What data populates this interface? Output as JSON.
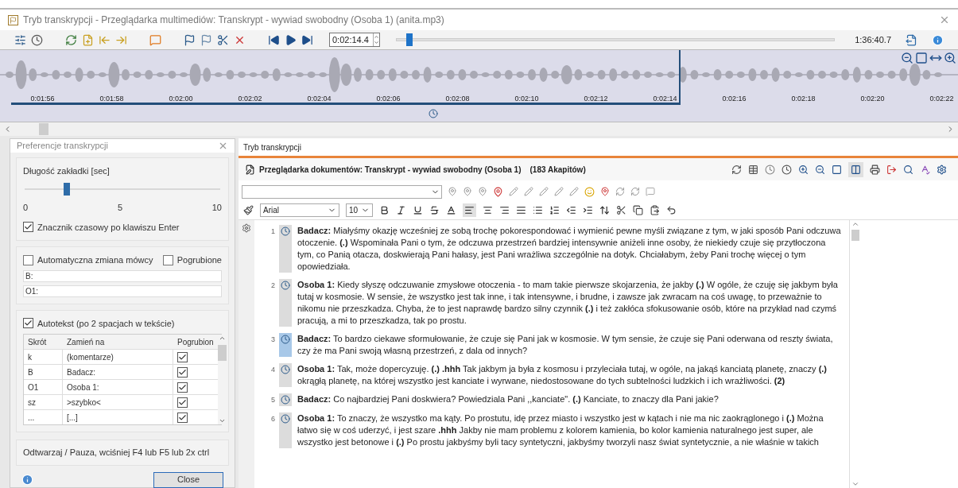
{
  "window": {
    "title": "Tryb transkrypcji - Przeglądarka multimediów: Transkrypt - wywiad swobodny (Osoba 1) (anita.mp3)"
  },
  "player": {
    "position": "0:02:14.4",
    "seek": {
      "level": 0.023
    },
    "duration": "1:36:40.7",
    "timeline": [
      "0:01:56",
      "0:01:58",
      "0:02:00",
      "0:02:02",
      "0:02:04",
      "0:02:06",
      "0:02:08",
      "0:02:10",
      "0:02:12",
      "0:02:14",
      "0:02:16",
      "0:02:18",
      "0:02:20",
      "0:02:22"
    ]
  },
  "preferences": {
    "title": "Preferencje transkrypcji",
    "tab_length": {
      "label": "Długość zakładki [sec]",
      "level": 0.2,
      "scale": [
        "0",
        "5",
        "10"
      ]
    },
    "enter_timestamp": {
      "label": "Znacznik czasowy po klawiszu Enter",
      "checked": true
    },
    "auto_speaker": {
      "label": "Automatyczna zmiana mówcy",
      "checked": false
    },
    "bold": {
      "label": "Pogrubione",
      "checked": false
    },
    "speakers": [
      "B:",
      "O1:"
    ],
    "autotext": {
      "label": "Autotekst (po 2 spacjach w tekście)",
      "checked": true,
      "columns": [
        "Skrót",
        "Zamień na",
        "Pogrubion"
      ],
      "rows": [
        {
          "abbr": "k",
          "replace": "(komentarze)",
          "bold": true
        },
        {
          "abbr": "B",
          "replace": "Badacz:",
          "bold": true
        },
        {
          "abbr": "O1",
          "replace": "Osoba 1:",
          "bold": true
        },
        {
          "abbr": "sz",
          "replace": ">szybko<",
          "bold": true
        },
        {
          "abbr": "...",
          "replace": "[...]",
          "bold": true
        }
      ]
    },
    "hint": "Odtwarzaj / Pauza, wciśniej F4 lub F5 lub 2x ctrl",
    "close": "Close"
  },
  "transcript": {
    "tab": "Tryb transkrypcji",
    "title": "Przeglądarka dokumentów: Transkrypt - wywiad swobodny (Osoba 1)",
    "count": "(183 Akapitów)",
    "font": "Arial",
    "size": "10",
    "paragraphs": [
      {
        "number": "1",
        "selected": false,
        "text": "**Badacz:** Miałyśmy okazję wcześniej ze sobą trochę pokorespondować i wymienić pewne myśli związane z tym, w jaki sposób Pani odczuwa otoczenie. **(.)** Wspominała Pani o tym, że odczuwa przestrzeń bardziej intensywnie aniżeli inne osoby, że niekiedy czuje się przytłoczona tym, co  Panią otacza, doskwierają Pani hałasy, jest Pani wrażliwa szczególnie na dotyk. Chciałabym, żeby Pani trochę więcej o tym opowiedziała."
      },
      {
        "number": "2",
        "selected": false,
        "text": "**Osoba 1:** Kiedy słyszę odczuwanie zmysłowe otoczenia  - to mam takie pierwsze skojarzenia, że jakby **(.)** W ogóle, że czuję się jakbym była tutaj w kosmosie. W sensie, że wszystko jest tak inne, i tak intensywne, i brudne, i zawsze jak zwracam na coś uwagę, to przeważnie to nikomu nie przeszkadza. Chyba, że to jest naprawdę bardzo silny czynnik **(.)** i też zakłóca sfokusowanie osób, które na przykład nad czymś pracują, a mi to przeszkadza, tak po prostu."
      },
      {
        "number": "3",
        "selected": true,
        "text": "**Badacz:** To bardzo ciekawe sformułowanie, że czuje się Pani jak w kosmosie. W tym sensie, że czuje się Pani oderwana od reszty świata, czy że ma Pani swoją własną przestrzeń, z dala od innych?"
      },
      {
        "number": "4",
        "selected": false,
        "text": "**Osoba 1:** Tak, może dopercyzuję. **(.)** **.hhh** Tak jakbym ja była z kosmosu i przyleciała tutaj, w ogóle, na jakąś kanciatą planetę, znaczy **(.)** okrągłą planetę, na której wszystko jest kanciate i wyrwane, niedostosowane do tych subtelności ludzkich i ich wrażliwości. **(2)**"
      },
      {
        "number": "5",
        "selected": false,
        "text": "**Badacz:** Co najbardziej Pani doskwiera? Powiedziala Pani ,,kanciate\". **(.)** Kanciate, to znaczy dla Pani jakie?"
      },
      {
        "number": "6",
        "selected": false,
        "text": "**Osoba 1:** To znaczy, że wszystko ma kąty. Po prostutu, idę przez miasto i wszystko jest w kątach i nie ma nic zaokrąglonego i **(.)** Można łatwo się w coś uderzyć, i jest szare **.hhh** Jakby nie mam problemu z kolorem kamienia, bo kolor kamienia naturalnego jest super, ale wszystko jest betonowe i **(.)** Po prostu jakbyśmy byli tacy syntetyczni, jakbyśmy tworzyli nasz świat syntetycznie, a nie właśnie w takich"
      }
    ]
  }
}
